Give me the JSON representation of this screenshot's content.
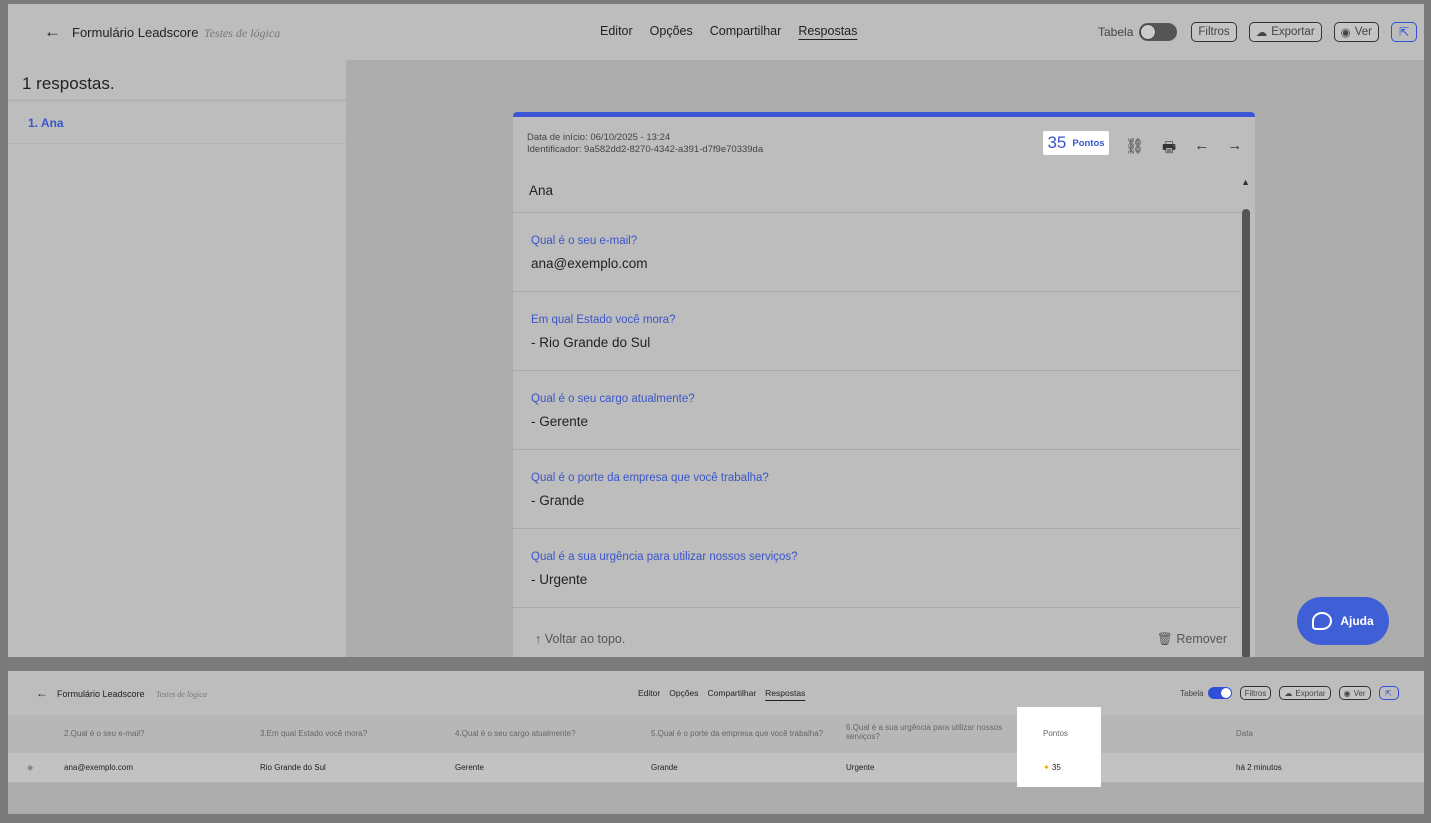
{
  "header": {
    "back_label": "←",
    "app_title": "Formulário Leadscore",
    "subtitle": "Testes de lógica",
    "nav": [
      "Editor",
      "Opções",
      "Compartilhar",
      "Respostas"
    ],
    "table_label": "Tabela",
    "filters_label": "Filtros",
    "export_label": "Exportar",
    "view_label": "Ver"
  },
  "sidebar": {
    "count": "1 respostas.",
    "items": [
      "1. Ana"
    ]
  },
  "response": {
    "start_date": "Data de início: 06/10/2025 - 13:24",
    "identifier": "Identificador: 9a582dd2-8270-4342-a391-d7f9e70339da",
    "points_value": "35",
    "points_label": "Pontos",
    "name": "Ana",
    "qa": [
      {
        "q": "Qual é o seu e-mail?",
        "a": "ana@exemplo.com"
      },
      {
        "q": "Em qual Estado você mora?",
        "a": "- Rio Grande do Sul"
      },
      {
        "q": "Qual é o seu cargo atualmente?",
        "a": "- Gerente"
      },
      {
        "q": "Qual é o porte da empresa que você trabalha?",
        "a": "- Grande"
      },
      {
        "q": "Qual é a sua urgência para utilizar nossos serviços?",
        "a": "- Urgente"
      }
    ],
    "back_to_top": "↑ Voltar ao topo.",
    "remove": "🗑 Remover"
  },
  "help": {
    "label": "Ajuda"
  },
  "table": {
    "columns": [
      "2.Qual é o seu e-mail?",
      "3.Em qual Estado você mora?",
      "4.Qual é o seu cargo atualmente?",
      "5.Qual é o porte da empresa que você trabalha?",
      "6.Qual é a sua urgência para utilizar nossos serviços?",
      "Pontos",
      "Data"
    ],
    "row": [
      "ana@exemplo.com",
      "Rio Grande do Sul",
      "Gerente",
      "Grande",
      "Urgente",
      "35",
      "há 2 minutos"
    ]
  },
  "colors": {
    "accent": "#3c56d6",
    "toggle_on": "#2f4fd8"
  }
}
